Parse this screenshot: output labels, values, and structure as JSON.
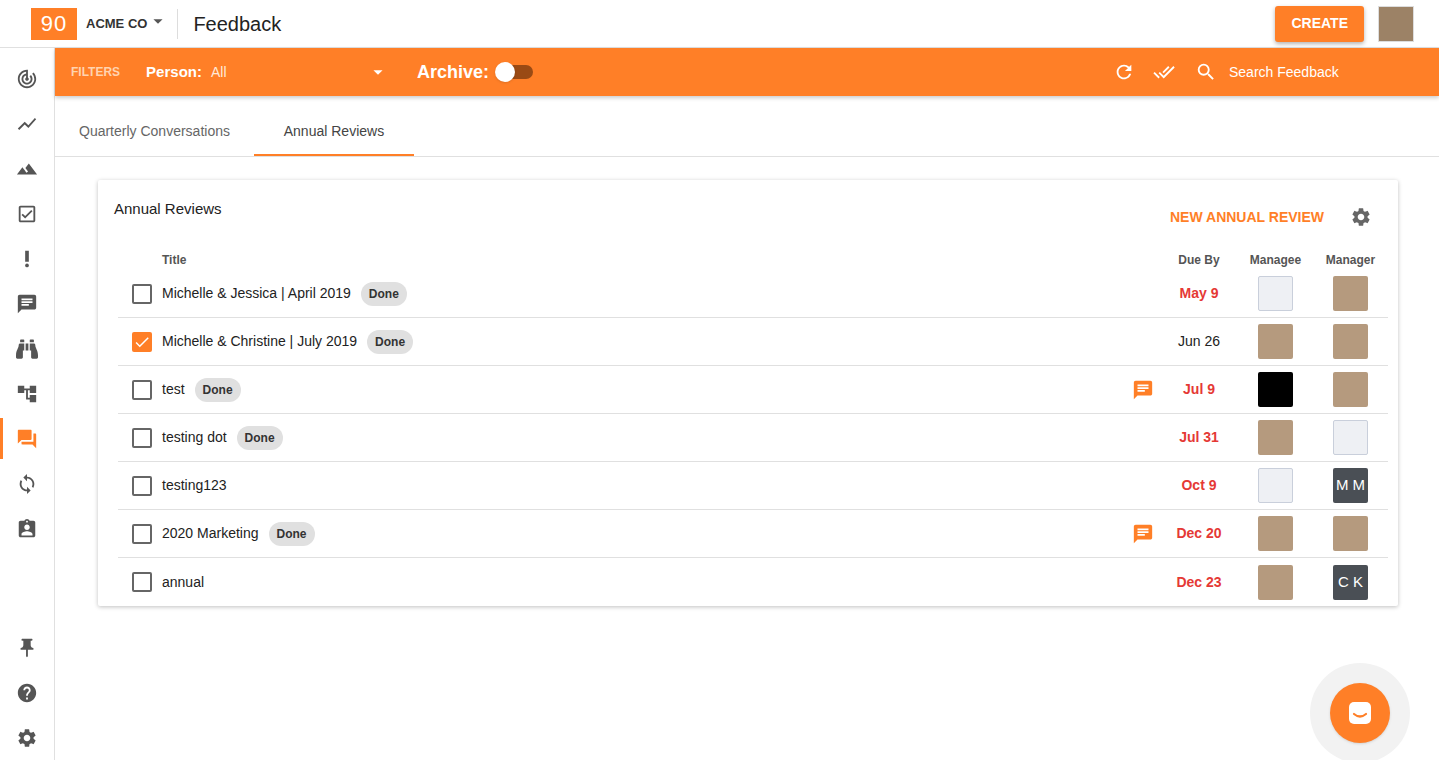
{
  "brand": {
    "logo": "90",
    "company": "ACME CO"
  },
  "page_title": "Feedback",
  "create_button": "CREATE",
  "sidebar": {
    "items": [
      {
        "selected": false
      },
      {
        "selected": false
      },
      {
        "selected": false
      },
      {
        "selected": false
      },
      {
        "selected": false
      },
      {
        "selected": false
      },
      {
        "selected": false
      },
      {
        "selected": false
      },
      {
        "selected": true
      },
      {
        "selected": false
      },
      {
        "selected": false
      }
    ],
    "bottom_items": [
      {
        "selected": false
      },
      {
        "selected": false
      },
      {
        "selected": false
      }
    ]
  },
  "filters": {
    "label": "FILTERS",
    "person_label": "Person:",
    "person_value": "All",
    "archive_label": "Archive:",
    "archive_on": false,
    "search_placeholder": "Search Feedback"
  },
  "tabs": [
    {
      "label": "Quarterly Conversations",
      "selected": false
    },
    {
      "label": "Annual Reviews",
      "selected": true
    }
  ],
  "card": {
    "title": "Annual Reviews",
    "action": "NEW ANNUAL REVIEW"
  },
  "done_label": "Done",
  "table": {
    "columns": [
      "Title",
      "Due By",
      "Managee",
      "Manager"
    ],
    "rows": [
      {
        "title": "Michelle & Jessica | April 2019",
        "done": true,
        "checked": false,
        "comment": false,
        "due": "May 9",
        "overdue": true,
        "managee": {
          "kind": "brand",
          "initials": ""
        },
        "manager": {
          "kind": "photo",
          "initials": ""
        }
      },
      {
        "title": "Michelle & Christine | July 2019",
        "done": true,
        "checked": true,
        "comment": false,
        "due": "Jun 26",
        "overdue": false,
        "managee": {
          "kind": "photo",
          "initials": ""
        },
        "manager": {
          "kind": "photo",
          "initials": ""
        }
      },
      {
        "title": "test",
        "done": true,
        "checked": false,
        "comment": true,
        "due": "Jul 9",
        "overdue": true,
        "managee": {
          "kind": "dark",
          "initials": ""
        },
        "manager": {
          "kind": "photo",
          "initials": ""
        }
      },
      {
        "title": "testing dot",
        "done": true,
        "checked": false,
        "comment": false,
        "due": "Jul 31",
        "overdue": true,
        "managee": {
          "kind": "photo",
          "initials": ""
        },
        "manager": {
          "kind": "brand",
          "initials": ""
        }
      },
      {
        "title": "testing123",
        "done": false,
        "checked": false,
        "comment": false,
        "due": "Oct 9",
        "overdue": true,
        "managee": {
          "kind": "brand",
          "initials": ""
        },
        "manager": {
          "kind": "initials",
          "initials": "M M"
        }
      },
      {
        "title": "2020 Marketing",
        "done": true,
        "checked": false,
        "comment": true,
        "due": "Dec 20",
        "overdue": true,
        "managee": {
          "kind": "photo",
          "initials": ""
        },
        "manager": {
          "kind": "photo",
          "initials": ""
        }
      },
      {
        "title": "annual",
        "done": false,
        "checked": false,
        "comment": false,
        "due": "Dec 23",
        "overdue": true,
        "managee": {
          "kind": "photo",
          "initials": ""
        },
        "manager": {
          "kind": "initials",
          "initials": "C K"
        }
      }
    ]
  }
}
